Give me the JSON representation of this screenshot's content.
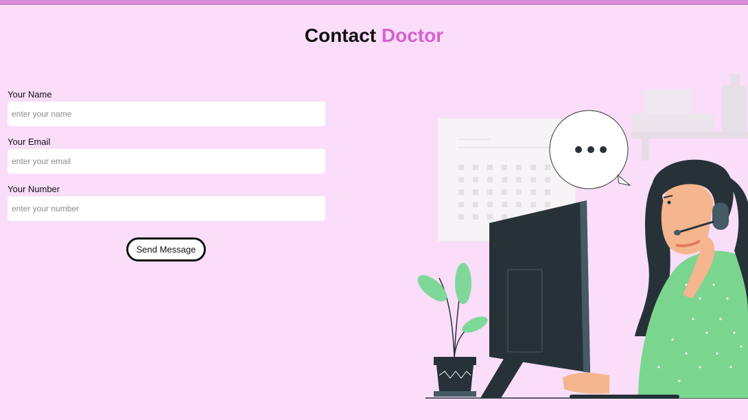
{
  "header": {
    "title_part1": "Contact",
    "title_part2": "Doctor"
  },
  "form": {
    "name_label": "Your Name",
    "name_placeholder": "enter your name",
    "email_label": "Your Email",
    "email_placeholder": "enter your email",
    "number_label": "Your Number",
    "number_placeholder": "enter your number",
    "submit_label": "Send Message"
  },
  "colors": {
    "background": "#f9ddf9",
    "accent": "#d95fd1",
    "top_bar": "#d98ad9"
  }
}
